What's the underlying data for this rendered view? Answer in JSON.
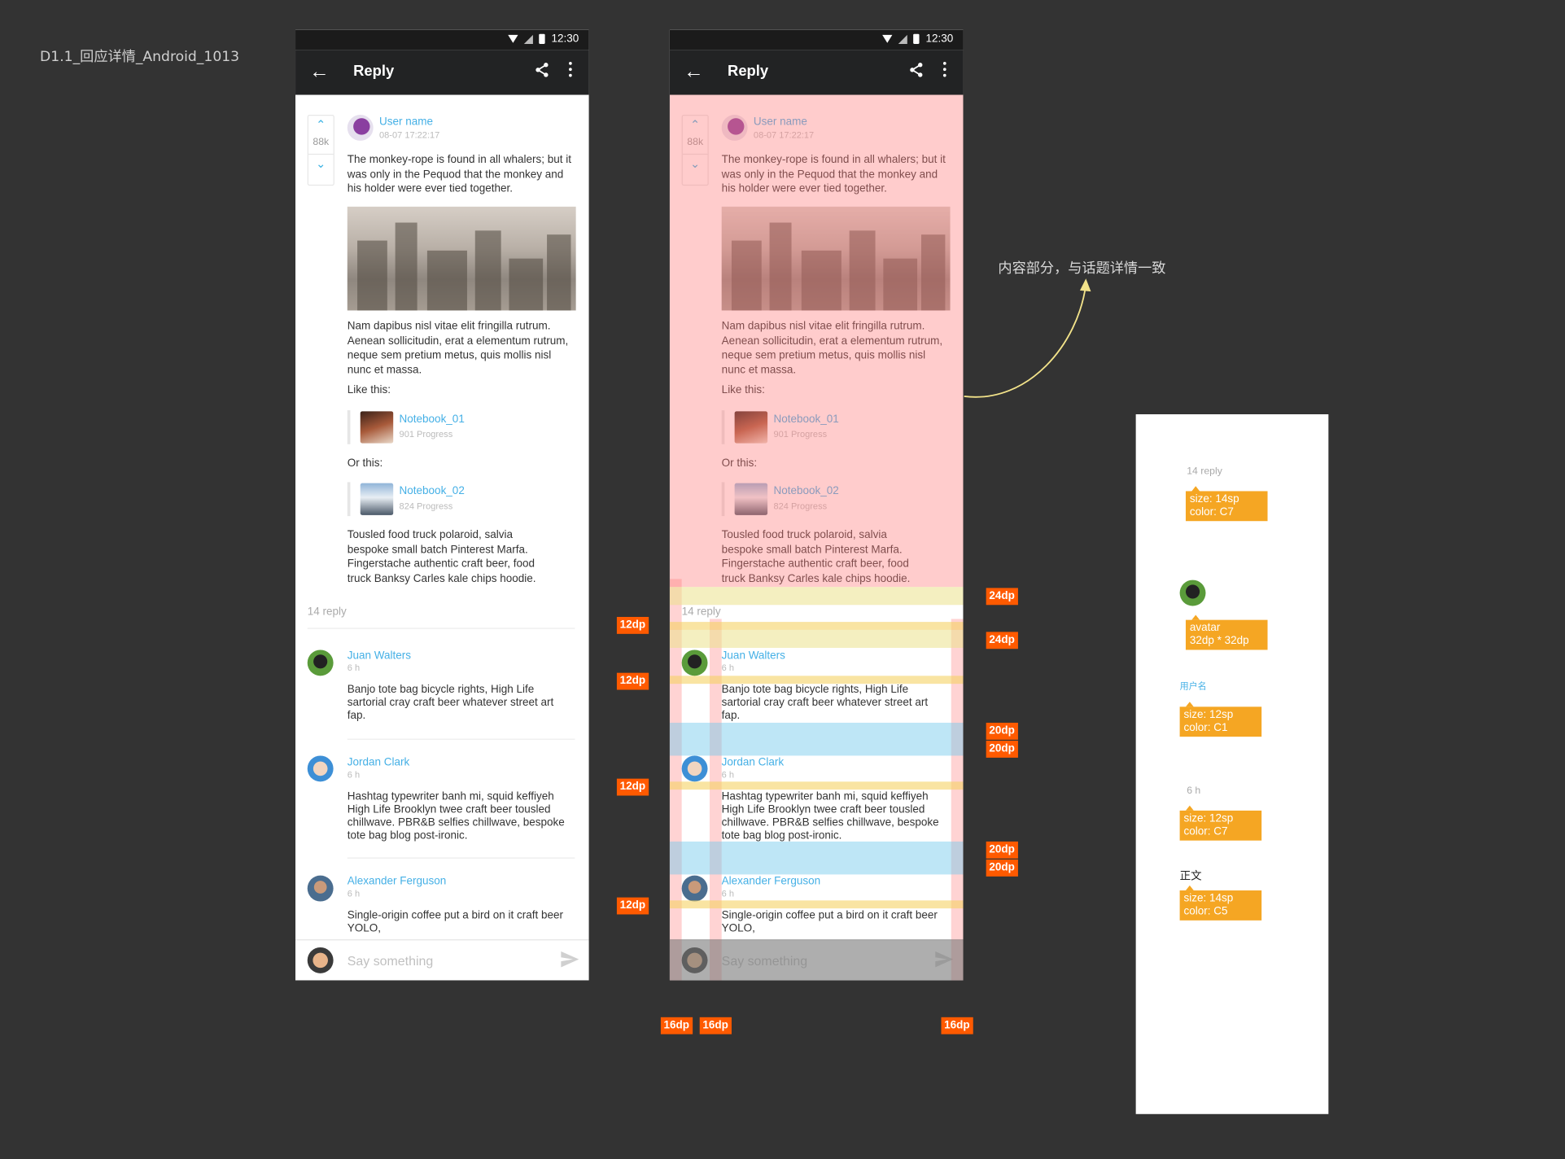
{
  "page_title": "D1.1_回应详情_Android_1013",
  "status_time": "12:30",
  "appbar": {
    "title": "Reply",
    "back_icon": "arrow-back-icon",
    "share_icon": "share-icon",
    "more_icon": "more-vert-icon"
  },
  "post": {
    "votes": "88k",
    "user_name": "User name",
    "timestamp": "08-07 17:22:17",
    "paragraph1": "The monkey-rope is found in all whalers; but it was only in the Pequod that the monkey and his holder were ever tied together.",
    "paragraph2": "Nam dapibus nisl vitae elit fringilla rutrum. Aenean sollicitudin, erat a elementum rutrum, neque sem pretium metus, quis mollis nisl nunc et massa.",
    "like_this": "Like this:",
    "or_this": "Or this:",
    "attachments": [
      {
        "name": "Notebook_01",
        "progress": "901 Progress"
      },
      {
        "name": "Notebook_02",
        "progress": "824 Progress"
      }
    ],
    "paragraph3": "Tousled food truck polaroid, salvia bespoke small batch Pinterest Marfa. Fingerstache authentic craft beer, food truck Banksy Carles kale chips hoodie."
  },
  "reply_count": "14 reply",
  "replies": [
    {
      "name": "Juan Walters",
      "time": "6 h",
      "text": "Banjo tote bag bicycle rights, High Life sartorial cray craft beer whatever street art fap."
    },
    {
      "name": "Jordan Clark",
      "time": "6 h",
      "text": "Hashtag typewriter banh mi, squid keffiyeh High Life Brooklyn twee craft beer tousled chillwave. PBR&B selfies chillwave, bespoke tote bag blog post-ironic."
    },
    {
      "name": "Alexander Ferguson",
      "time": "6 h",
      "text": "Single-origin coffee put a bird on it craft beer YOLO,"
    }
  ],
  "input": {
    "placeholder": "Say something",
    "send_icon": "send-icon"
  },
  "annotation": "内容部分，与话题详情一致",
  "dims": {
    "d12": "12dp",
    "d16": "16dp",
    "d20": "20dp",
    "d24": "24dp"
  },
  "spec": {
    "reply_label": "14 reply",
    "reply_note": [
      "size: 14sp",
      "color: C7"
    ],
    "avatar_note": [
      "avatar",
      "32dp * 32dp"
    ],
    "username_label": "用户名",
    "username_note": [
      "size: 12sp",
      "color: C1"
    ],
    "time_label": "6 h",
    "time_note": [
      "size: 12sp",
      "color: C7"
    ],
    "body_label": "正文",
    "body_note": [
      "size: 14sp",
      "color: C5"
    ]
  },
  "colors": {
    "accent": "#45b0e6",
    "tag": "#ff5a00",
    "note": "#f5a623"
  }
}
